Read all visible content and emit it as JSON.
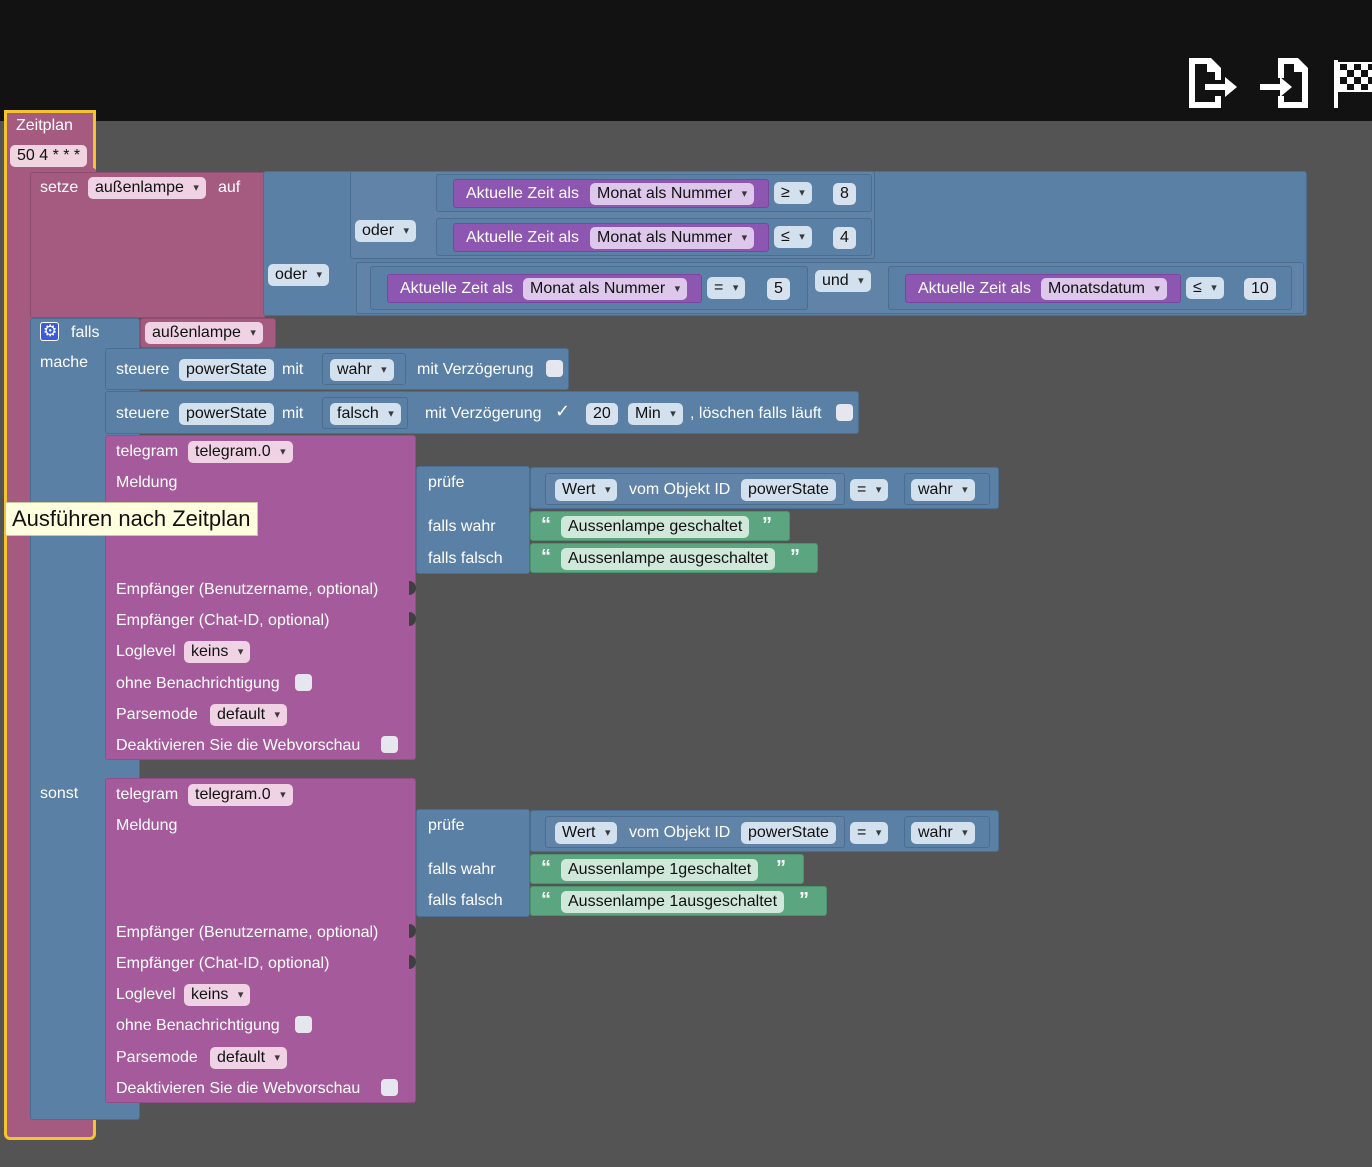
{
  "toolbar": {
    "icons": [
      "export-icon",
      "import-icon",
      "checkered-flag-icon"
    ]
  },
  "schedule": {
    "title": "Zeitplan",
    "cron": "50 4 * * *",
    "tooltip": "Ausführen nach Zeitplan"
  },
  "set_block": {
    "setze": "setze",
    "variable": "außenlampe",
    "auf": "auf",
    "outer_or": "oder",
    "inner_or": "oder",
    "and": "und",
    "cond1": {
      "prefix": "Aktuelle Zeit als",
      "unit": "Monat als Nummer",
      "op": "≥",
      "value": "8"
    },
    "cond2": {
      "prefix": "Aktuelle Zeit als",
      "unit": "Monat als Nummer",
      "op": "≤",
      "value": "4"
    },
    "cond3": {
      "prefix": "Aktuelle Zeit als",
      "unit": "Monat als Nummer",
      "op": "=",
      "value": "5"
    },
    "cond4": {
      "prefix": "Aktuelle Zeit als",
      "unit": "Monatsdatum",
      "op": "≤",
      "value": "10"
    }
  },
  "if_block": {
    "falls": "falls",
    "condition_var": "außenlampe",
    "mache": "mache",
    "sonst": "sonst"
  },
  "control1": {
    "steuere": "steuere",
    "object": "powerState",
    "mit": "mit",
    "value": "wahr",
    "delay_label": "mit Verzögerung"
  },
  "control2": {
    "steuere": "steuere",
    "object": "powerState",
    "mit": "mit",
    "value": "falsch",
    "delay_label": "mit Verzögerung",
    "delay_value": "20",
    "delay_unit": "Min",
    "clear_label": ", löschen falls läuft"
  },
  "telegram1": {
    "title": "telegram",
    "instance": "telegram.0",
    "message": "Meldung",
    "check": "prüfe",
    "value_label": "Wert",
    "from_object": "vom Objekt ID",
    "object": "powerState",
    "op": "=",
    "compare": "wahr",
    "if_true": "falls wahr",
    "true_text": "Aussenlampe geschaltet",
    "if_false": "falls falsch",
    "false_text": "Aussenlampe ausgeschaltet",
    "recipient_user": "Empfänger (Benutzername, optional)",
    "recipient_chat": "Empfänger (Chat-ID, optional)",
    "loglevel": "Loglevel",
    "loglevel_value": "keins",
    "silent": "ohne Benachrichtigung",
    "parsemode": "Parsemode",
    "parsemode_value": "default",
    "disable_preview": "Deaktivieren Sie die Webvorschau"
  },
  "telegram2": {
    "title": "telegram",
    "instance": "telegram.0",
    "message": "Meldung",
    "check": "prüfe",
    "value_label": "Wert",
    "from_object": "vom Objekt ID",
    "object": "powerState",
    "op": "=",
    "compare": "wahr",
    "if_true": "falls wahr",
    "true_text": "Aussenlampe  1geschaltet",
    "if_false": "falls falsch",
    "false_text": "Aussenlampe 1ausgeschaltet",
    "recipient_user": "Empfänger (Benutzername, optional)",
    "recipient_chat": "Empfänger (Chat-ID, optional)",
    "loglevel": "Loglevel",
    "loglevel_value": "keins",
    "silent": "ohne Benachrichtigung",
    "parsemode": "Parsemode",
    "parsemode_value": "default",
    "disable_preview": "Deaktivieren Sie die Webvorschau"
  },
  "colors": {
    "canvas": "#545454",
    "topbar": "#121212",
    "logic": "#5b80a5",
    "time": "#8d56b1",
    "telegram": "#a55b9b",
    "variable": "#a55b80",
    "text": "#5ba580",
    "schedule_border": "#f4c430",
    "gear": "#3b5bdb"
  }
}
